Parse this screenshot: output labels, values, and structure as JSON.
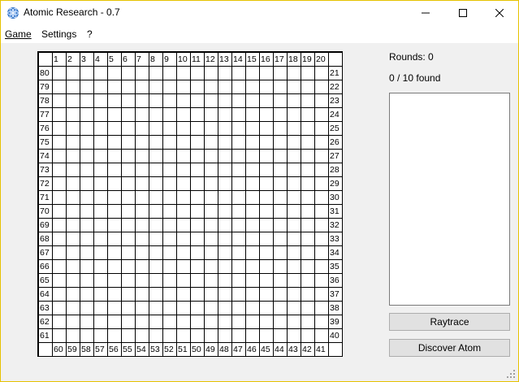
{
  "window": {
    "title": "Atomic Research - 0.7",
    "minimize_glyph": "—",
    "maximize_glyph": "☐",
    "close_glyph": "✕"
  },
  "menu": {
    "items": [
      "Game",
      "Settings",
      "?"
    ]
  },
  "grid": {
    "size": 20,
    "top": [
      "1",
      "2",
      "3",
      "4",
      "5",
      "6",
      "7",
      "8",
      "9",
      "10",
      "11",
      "12",
      "13",
      "14",
      "15",
      "16",
      "17",
      "18",
      "19",
      "20"
    ],
    "right": [
      "21",
      "22",
      "23",
      "24",
      "25",
      "26",
      "27",
      "28",
      "29",
      "30",
      "31",
      "32",
      "33",
      "34",
      "35",
      "36",
      "37",
      "38",
      "39",
      "40"
    ],
    "bottom": [
      "60",
      "59",
      "58",
      "57",
      "56",
      "55",
      "54",
      "53",
      "52",
      "51",
      "50",
      "49",
      "48",
      "47",
      "46",
      "45",
      "44",
      "43",
      "42",
      "41"
    ],
    "left": [
      "80",
      "79",
      "78",
      "77",
      "76",
      "75",
      "74",
      "73",
      "72",
      "71",
      "70",
      "69",
      "68",
      "67",
      "66",
      "65",
      "64",
      "63",
      "62",
      "61"
    ]
  },
  "side": {
    "rounds": "Rounds: 0",
    "found": "0 / 10 found",
    "raytrace_label": "Raytrace",
    "discover_label": "Discover Atom"
  }
}
